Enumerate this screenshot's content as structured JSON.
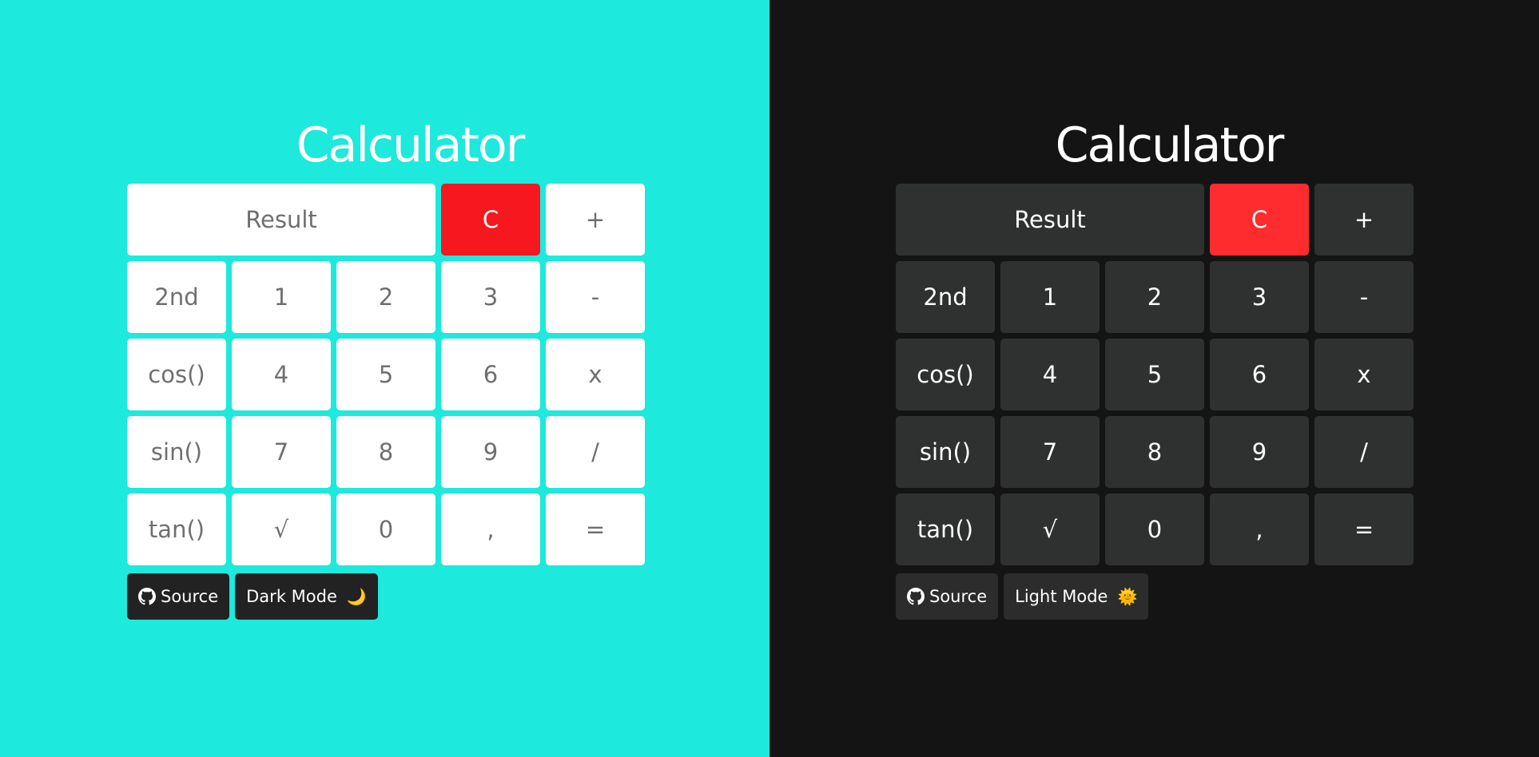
{
  "panels": {
    "light": {
      "title": "Calculator",
      "mode_toggle_label": "Dark Mode",
      "mode_toggle_emoji": "🌙",
      "source_label": "Source",
      "colors": {
        "background": "#1de9dc",
        "key": "#ffffff",
        "key_text": "#6f6f6f",
        "clear": "#f7171e",
        "footer_button": "#222222"
      }
    },
    "dark": {
      "title": "Calculator",
      "mode_toggle_label": "Light Mode",
      "mode_toggle_emoji": "🌞",
      "source_label": "Source",
      "colors": {
        "background": "#141414",
        "key": "#2f3131",
        "key_text": "#ffffff",
        "clear": "#fe2c2e",
        "footer_button": "#2c2c2c"
      }
    }
  },
  "keys": {
    "result": "Result",
    "clear": "C",
    "plus": "+",
    "second": "2nd",
    "one": "1",
    "two": "2",
    "three": "3",
    "minus": "-",
    "cos": "cos()",
    "four": "4",
    "five": "5",
    "six": "6",
    "times": "x",
    "sin": "sin()",
    "seven": "7",
    "eight": "8",
    "nine": "9",
    "divide": "/",
    "tan": "tan()",
    "sqrt": "√",
    "zero": "0",
    "comma": ",",
    "equals": "="
  },
  "icons": {
    "source": "github-icon"
  }
}
